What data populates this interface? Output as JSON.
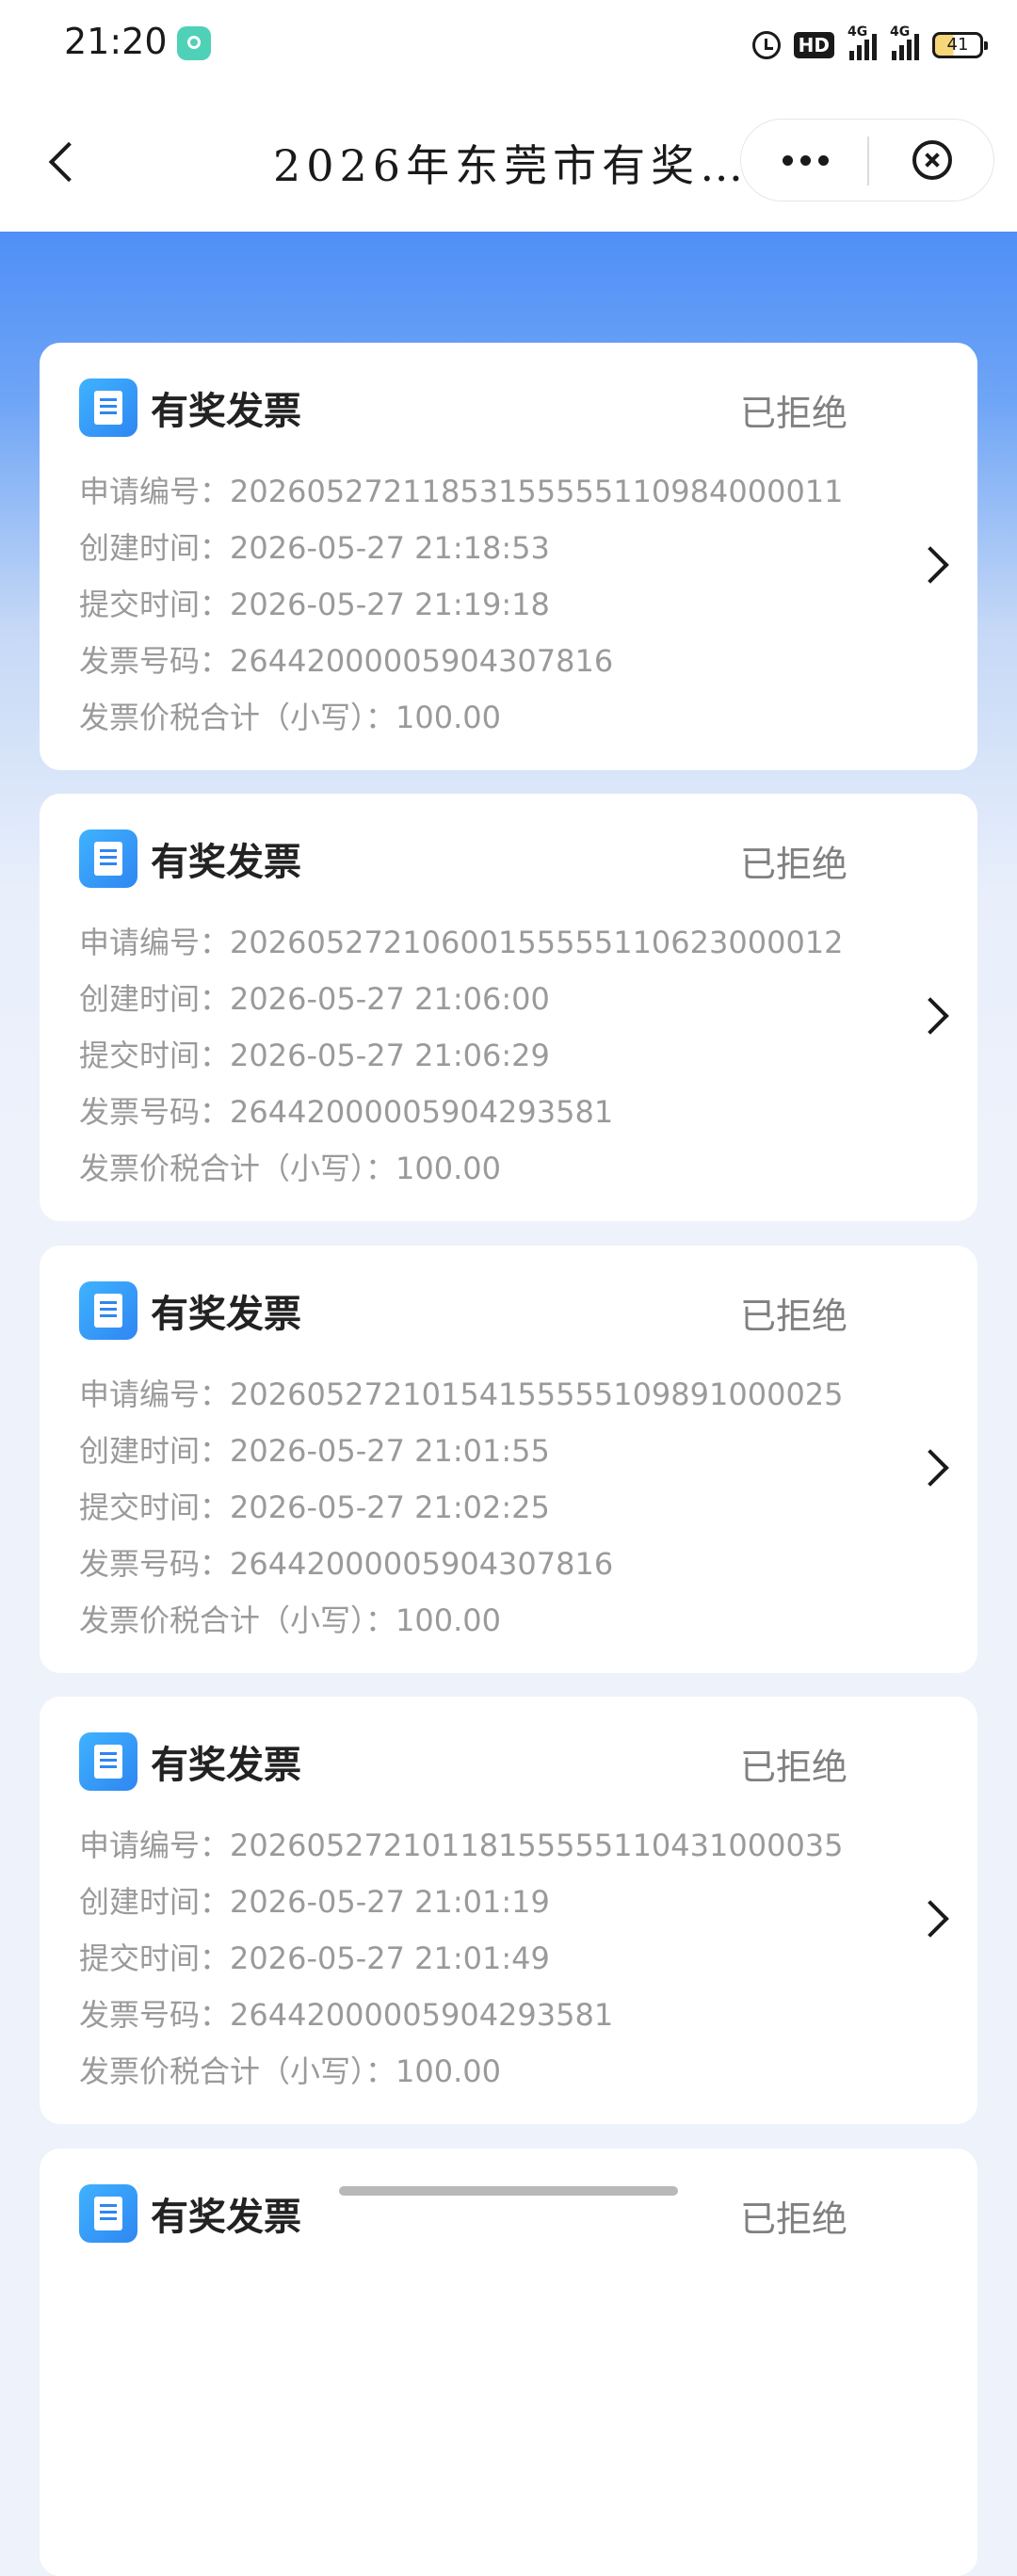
{
  "status_bar": {
    "time": "21:20",
    "hd_label": "HD",
    "signal1_label": "4G",
    "signal2_label": "4G",
    "battery": "41",
    "icons": [
      "app-notification-icon",
      "alarm-icon",
      "hd-icon",
      "signal-icon",
      "signal-icon",
      "battery-icon"
    ]
  },
  "nav": {
    "title": "2026年东莞市有奖发…",
    "back_icon": "chevron-left-icon",
    "more_icon": "more-dots-icon",
    "close_icon": "close-circle-icon"
  },
  "labels": {
    "app_no": "申请编号：",
    "created": "创建时间：",
    "submitted": "提交时间：",
    "invoice_no": "发票号码：",
    "total": "发票价税合计（小写）："
  },
  "cards": [
    {
      "title": "有奖发票",
      "status": "已拒绝",
      "app_no": "20260527211853155555110984000011",
      "created": "2026-05-27 21:18:53",
      "submitted": "2026-05-27 21:19:18",
      "invoice_no": "26442000005904307816",
      "total": "100.00"
    },
    {
      "title": "有奖发票",
      "status": "已拒绝",
      "app_no": "20260527210600155555110623000012",
      "created": "2026-05-27 21:06:00",
      "submitted": "2026-05-27 21:06:29",
      "invoice_no": "26442000005904293581",
      "total": "100.00"
    },
    {
      "title": "有奖发票",
      "status": "已拒绝",
      "app_no": "20260527210154155555109891000025",
      "created": "2026-05-27 21:01:55",
      "submitted": "2026-05-27 21:02:25",
      "invoice_no": "26442000005904307816",
      "total": "100.00"
    },
    {
      "title": "有奖发票",
      "status": "已拒绝",
      "app_no": "20260527210118155555110431000035",
      "created": "2026-05-27 21:01:19",
      "submitted": "2026-05-27 21:01:49",
      "invoice_no": "26442000005904293581",
      "total": "100.00"
    },
    {
      "title": "有奖发票",
      "status": "已拒绝"
    }
  ]
}
